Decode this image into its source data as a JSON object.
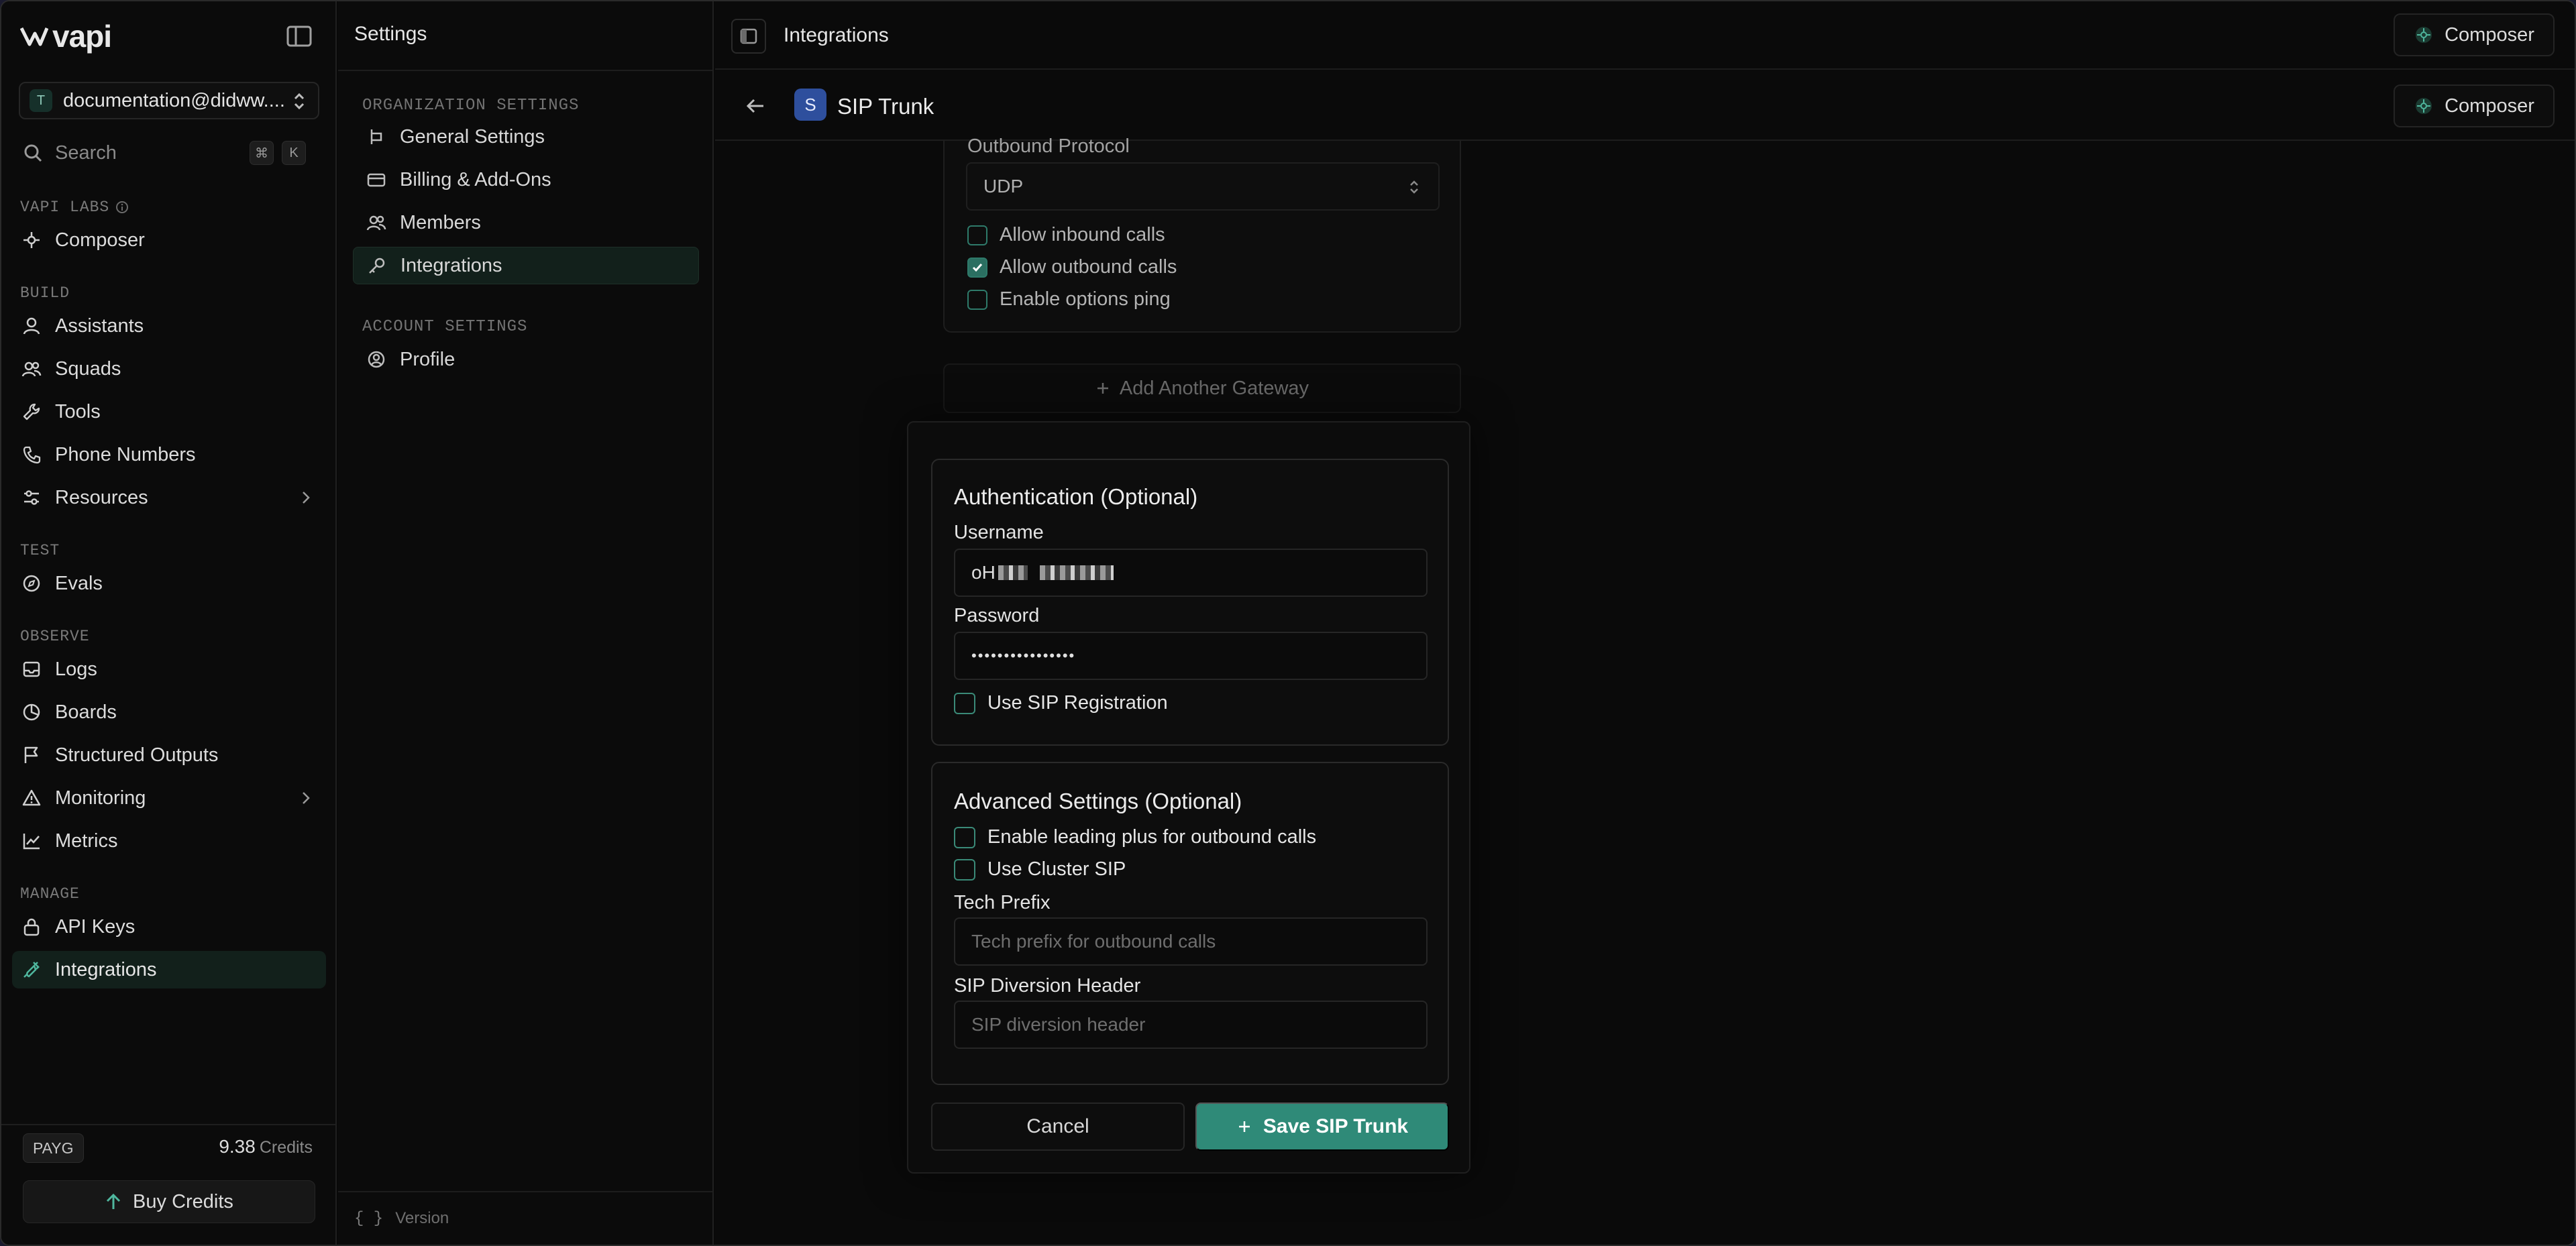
{
  "brand": {
    "logo_text": "vapi"
  },
  "org": {
    "badge": "T",
    "name": "documentation@didww...."
  },
  "search": {
    "placeholder": "Search",
    "shortcut_mod": "⌘",
    "shortcut_key": "K"
  },
  "sidebar": {
    "sections": [
      {
        "label": "VAPI LABS",
        "items": [
          {
            "label": "Composer",
            "icon": "composer-icon"
          }
        ]
      },
      {
        "label": "BUILD",
        "items": [
          {
            "label": "Assistants",
            "icon": "user-icon"
          },
          {
            "label": "Squads",
            "icon": "users-icon"
          },
          {
            "label": "Tools",
            "icon": "wrench-icon"
          },
          {
            "label": "Phone Numbers",
            "icon": "phone-icon"
          },
          {
            "label": "Resources",
            "icon": "sliders-icon"
          }
        ]
      },
      {
        "label": "TEST",
        "items": [
          {
            "label": "Evals",
            "icon": "compass-icon"
          }
        ]
      },
      {
        "label": "OBSERVE",
        "items": [
          {
            "label": "Logs",
            "icon": "inbox-icon"
          },
          {
            "label": "Boards",
            "icon": "pie-icon"
          },
          {
            "label": "Structured Outputs",
            "icon": "flag-icon"
          },
          {
            "label": "Monitoring",
            "icon": "warning-icon"
          },
          {
            "label": "Metrics",
            "icon": "chart-icon"
          }
        ]
      },
      {
        "label": "MANAGE",
        "items": [
          {
            "label": "API Keys",
            "icon": "lock-icon"
          },
          {
            "label": "Integrations",
            "icon": "plug-icon"
          }
        ]
      }
    ]
  },
  "billing": {
    "plan": "PAYG",
    "credits": "9.38",
    "credits_unit": "Credits",
    "buy_label": "Buy Credits"
  },
  "settings": {
    "title": "Settings",
    "org_label": "ORGANIZATION SETTINGS",
    "org_items": [
      "General Settings",
      "Billing & Add-Ons",
      "Members",
      "Integrations"
    ],
    "account_label": "ACCOUNT SETTINGS",
    "account_items": [
      "Profile"
    ],
    "version_label": "Version"
  },
  "topbar": {
    "title": "Integrations",
    "composer_label": "Composer"
  },
  "subbar": {
    "badge": "S",
    "title": "SIP Trunk",
    "composer_label": "Composer"
  },
  "gateway": {
    "outbound_protocol_label": "Outbound Protocol",
    "outbound_protocol_value": "UDP",
    "allow_inbound_label": "Allow inbound calls",
    "allow_inbound": false,
    "allow_outbound_label": "Allow outbound calls",
    "allow_outbound": true,
    "options_ping_label": "Enable options ping",
    "options_ping": false,
    "add_gateway_label": "Add Another Gateway"
  },
  "auth": {
    "title": "Authentication (Optional)",
    "username_label": "Username",
    "username_value": "oH",
    "password_label": "Password",
    "password_value": "••••••••••••••••",
    "sip_registration_label": "Use SIP Registration"
  },
  "advanced": {
    "title": "Advanced Settings (Optional)",
    "leading_plus_label": "Enable leading plus for outbound calls",
    "cluster_sip_label": "Use Cluster SIP",
    "tech_prefix_label": "Tech Prefix",
    "tech_prefix_placeholder": "Tech prefix for outbound calls",
    "diversion_label": "SIP Diversion Header",
    "diversion_placeholder": "SIP diversion header"
  },
  "actions": {
    "cancel_label": "Cancel",
    "save_label": "Save SIP Trunk"
  },
  "colors": {
    "accent": "#2f8a78",
    "background": "#0a0a0a",
    "active_nav": "#12201b"
  }
}
